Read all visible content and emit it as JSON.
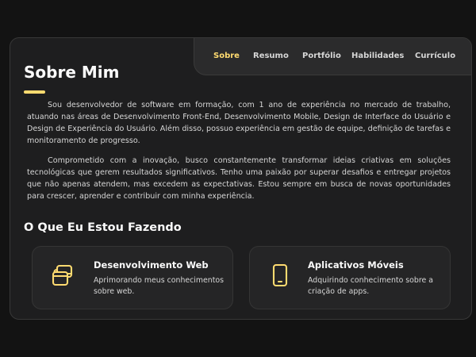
{
  "nav": {
    "items": [
      "Sobre",
      "Resumo",
      "Portfólio",
      "Habilidades",
      "Currículo"
    ],
    "active_color": "#ffdb70"
  },
  "about": {
    "title": "Sobre Mim",
    "paragraphs": [
      "Sou desenvolvedor de software em formação, com 1 ano de experiência no mercado de trabalho, atuando nas áreas de Desenvolvimento Front-End, Desenvolvimento Mobile, Design de Interface do Usuário e Design de Experiência do Usuário. Além disso, possuo experiência em gestão de equipe, definição de tarefas e monitoramento de progresso.",
      "Comprometido com a inovação, busco constantemente transformar ideias criativas em soluções tecnológicas que gerem resultados significativos. Tenho uma paixão por superar desafios e entregar projetos que não apenas atendem, mas excedem as expectativas. Estou sempre em busca de novas oportunidades para crescer, aprender e contribuir com minha experiência."
    ]
  },
  "services": {
    "title": "O Que Eu Estou Fazendo",
    "items": [
      {
        "icon": "layers-icon",
        "title": "Desenvolvimento Web",
        "text": "Aprimorando meus conhecimentos sobre web."
      },
      {
        "icon": "smartphone-icon",
        "title": "Aplicativos Móveis",
        "text": "Adquirindo conhecimento sobre a criação de apps."
      }
    ]
  },
  "colors": {
    "accent": "#ffdb70",
    "background": "#131313",
    "card": "#1e1e1f"
  }
}
